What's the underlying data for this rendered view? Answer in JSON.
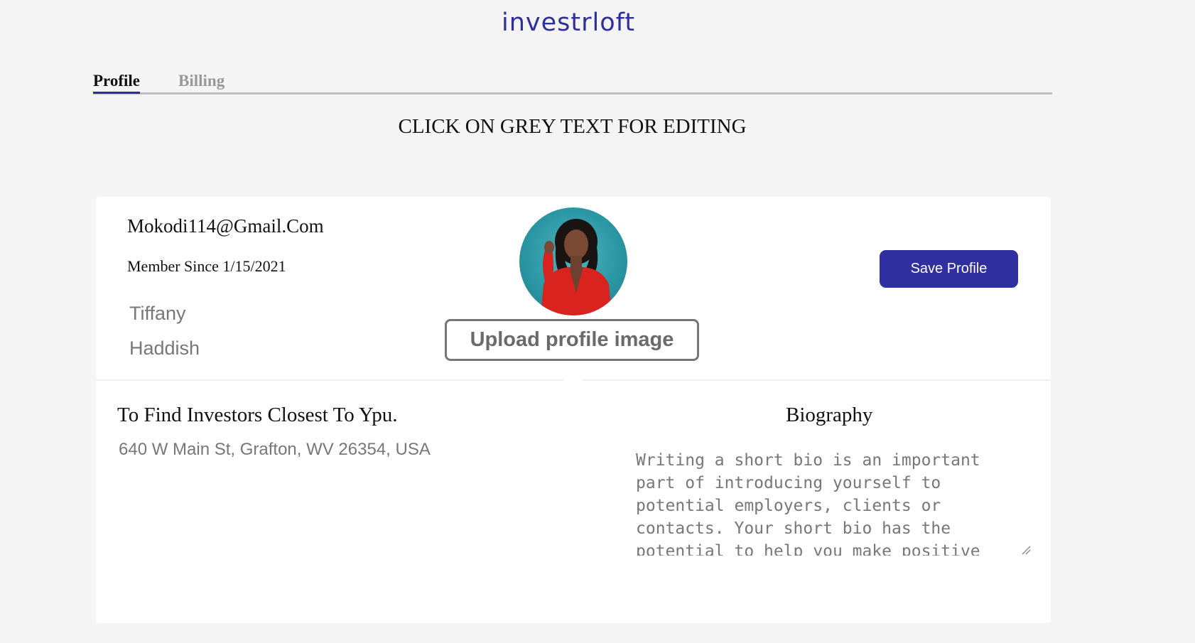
{
  "brand": {
    "logo_text": "investrloft",
    "color": "#2f2f9c"
  },
  "tabs": [
    {
      "label": "Profile",
      "active": true
    },
    {
      "label": "Billing",
      "active": false
    }
  ],
  "instruction": "CLICK ON GREY TEXT FOR EDITING",
  "profile": {
    "email": "Mokodi114@Gmail.Com",
    "member_since": "Member Since 1/15/2021",
    "first_name": "Tiffany",
    "last_name": "Haddish",
    "upload_label": "Upload profile image",
    "save_label": "Save Profile"
  },
  "location": {
    "heading": "To Find Investors Closest To Ypu.",
    "address": "640 W Main St, Grafton, WV 26354, USA"
  },
  "biography": {
    "heading": "Biography",
    "text": "Writing a short bio is an important part of introducing yourself to potential employers, clients or contacts. Your short bio has the potential to help you make positive"
  },
  "colors": {
    "accent": "#2f2fa0",
    "editable_text": "#777777",
    "background": "#f4f4f4"
  },
  "icons": {
    "resize": "resize-grip-icon"
  }
}
